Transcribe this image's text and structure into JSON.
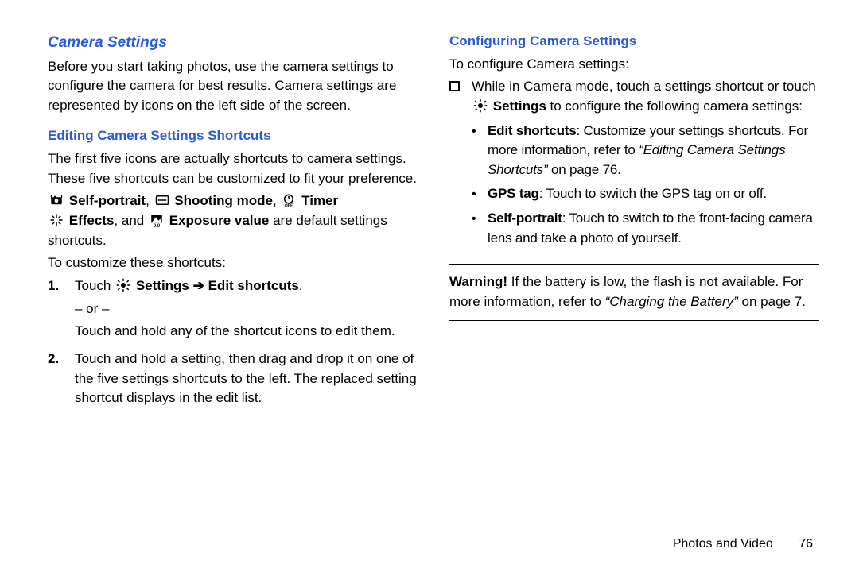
{
  "left": {
    "h_section": "Camera Settings",
    "intro": "Before you start taking photos, use the camera settings to configure the camera for best results. Camera settings are represented by icons on the left side of the screen.",
    "h_sub": "Editing Camera Settings Shortcuts",
    "p1": "The first five icons are actually shortcuts to camera settings. These five shortcuts can be customized to fit your preference.",
    "labels": {
      "selfportrait": "Self-portrait",
      "shootingmode": "Shooting mode",
      "timer": "Timer",
      "effects": "Effects",
      "exposure": "Exposure value"
    },
    "iconline_sep_comma": ", ",
    "iconline_and": ", and ",
    "iconline_tail": " are default settings shortcuts.",
    "p2": "To customize these shortcuts:",
    "steps": [
      {
        "num": "1.",
        "touch": "Touch ",
        "settings": "Settings",
        "arrow": " ➔ ",
        "edit": "Edit shortcuts",
        "period": ".",
        "or": "– or –",
        "alt": "Touch and hold any of the shortcut icons to edit them."
      },
      {
        "num": "2.",
        "text": "Touch and hold a setting, then drag and drop it on one of the five settings shortcuts to the left. The replaced setting shortcut displays in the edit list."
      }
    ]
  },
  "right": {
    "h_sub": "Configuring Camera Settings",
    "intro": "To configure Camera settings:",
    "bullet": {
      "pre": "While in Camera mode, touch a settings shortcut or touch ",
      "settings": "Settings",
      "post": " to configure the following camera settings:"
    },
    "items": [
      {
        "label": "Edit shortcuts",
        "text1": ": Customize your settings shortcuts. For more information, refer to ",
        "ref": "“Editing Camera Settings Shortcuts”",
        "text2": " on page 76."
      },
      {
        "label": "GPS tag",
        "text1": ": Touch to switch the GPS tag on or off."
      },
      {
        "label": "Self-portrait",
        "text1": ": Touch to switch to the front-facing camera lens and take a photo of yourself."
      }
    ],
    "warning": {
      "label": "Warning!",
      "text1": " If the battery is low, the flash is not available. For more information, refer to ",
      "ref": "“Charging the Battery”",
      "text2": " on page 7."
    }
  },
  "footer": {
    "section": "Photos and Video",
    "page": "76"
  }
}
